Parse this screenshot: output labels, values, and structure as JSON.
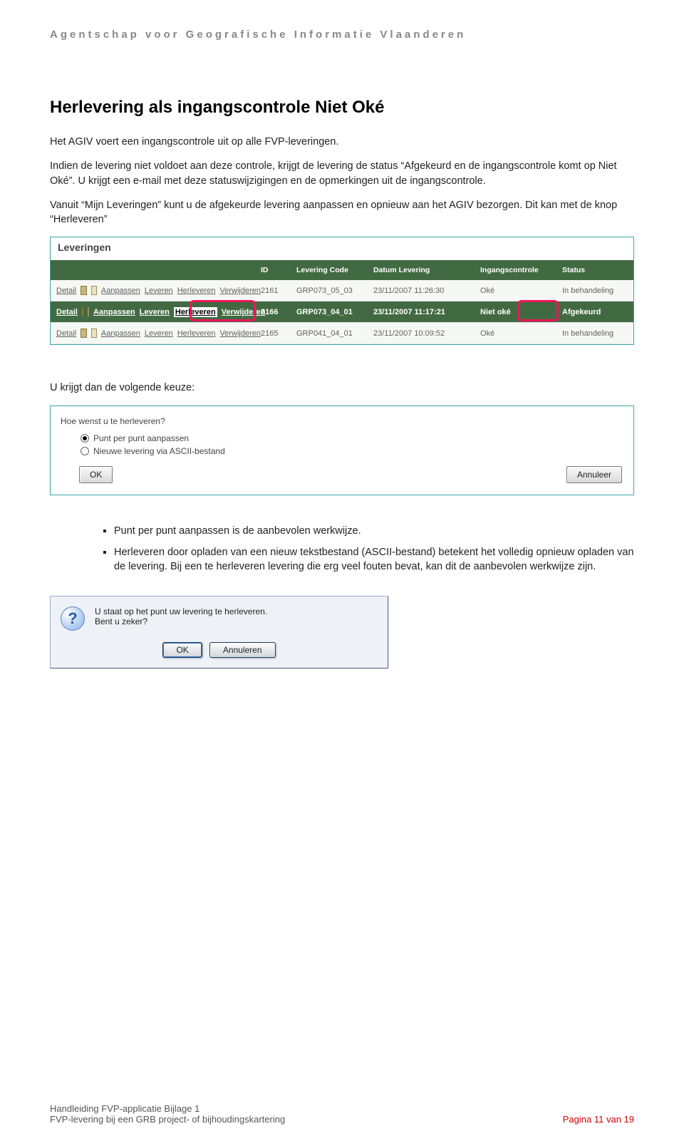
{
  "header": "Agentschap voor Geografische Informatie Vlaanderen",
  "title": "Herlevering als ingangscontrole Niet Oké",
  "p1": "Het AGIV voert een ingangscontrole uit op alle FVP-leveringen.",
  "p2": "Indien de levering niet voldoet aan deze controle, krijgt de levering de status “Afgekeurd en de ingangscontrole komt op Niet Oké”. U krijgt een e-mail met deze statuswijzigingen en de opmerkingen uit de ingangscontrole.",
  "p3": "Vanuit “Mijn Leveringen” kunt u de afgekeurde levering aanpassen en opnieuw aan het AGIV bezorgen. Dit kan met de knop “Herleveren”",
  "table": {
    "title": "Leveringen",
    "cols": {
      "id": "ID",
      "code": "Levering Code",
      "date": "Datum Levering",
      "ing": "Ingangscontrole",
      "status": "Status"
    },
    "actions": {
      "detail": "Detail",
      "aanpassen": "Aanpassen",
      "leveren": "Leveren",
      "herleveren": "Herleveren",
      "verwijderen": "Verwijderen"
    },
    "rows": [
      {
        "id": "2161",
        "code": "GRP073_05_03",
        "date": "23/11/2007 11:26:30",
        "ing": "Oké",
        "status": "In behandeling"
      },
      {
        "id": "2166",
        "code": "GRP073_04_01",
        "date": "23/11/2007 11:17:21",
        "ing": "Niet oké",
        "status": "Afgekeurd"
      },
      {
        "id": "2165",
        "code": "GRP041_04_01",
        "date": "23/11/2007 10:09:52",
        "ing": "Oké",
        "status": "In behandeling"
      }
    ]
  },
  "p4": "U krijgt dan de volgende keuze:",
  "choice": {
    "question": "Hoe wenst u te herleveren?",
    "opt1": "Punt per punt aanpassen",
    "opt2": "Nieuwe levering via ASCII-bestand",
    "ok": "OK",
    "cancel": "Annuleer"
  },
  "bullets": {
    "b1": "Punt per punt aanpassen is de aanbevolen werkwijze.",
    "b2": "Herleveren door opladen van een nieuw tekstbestand (ASCII-bestand) betekent het volledig opnieuw opladen van de levering. Bij een te herleveren levering die erg veel fouten bevat, kan dit de aanbevolen werkwijze zijn."
  },
  "confirm": {
    "line1": "U staat op het punt uw levering te herleveren.",
    "line2": "Bent u zeker?",
    "ok": "OK",
    "cancel": "Annuleren"
  },
  "footer": {
    "l1": "Handleiding FVP-applicatie   Bijlage 1",
    "l2": "FVP-levering bij een GRB project- of bijhoudingskartering",
    "page": "Pagina 11 van 19"
  }
}
